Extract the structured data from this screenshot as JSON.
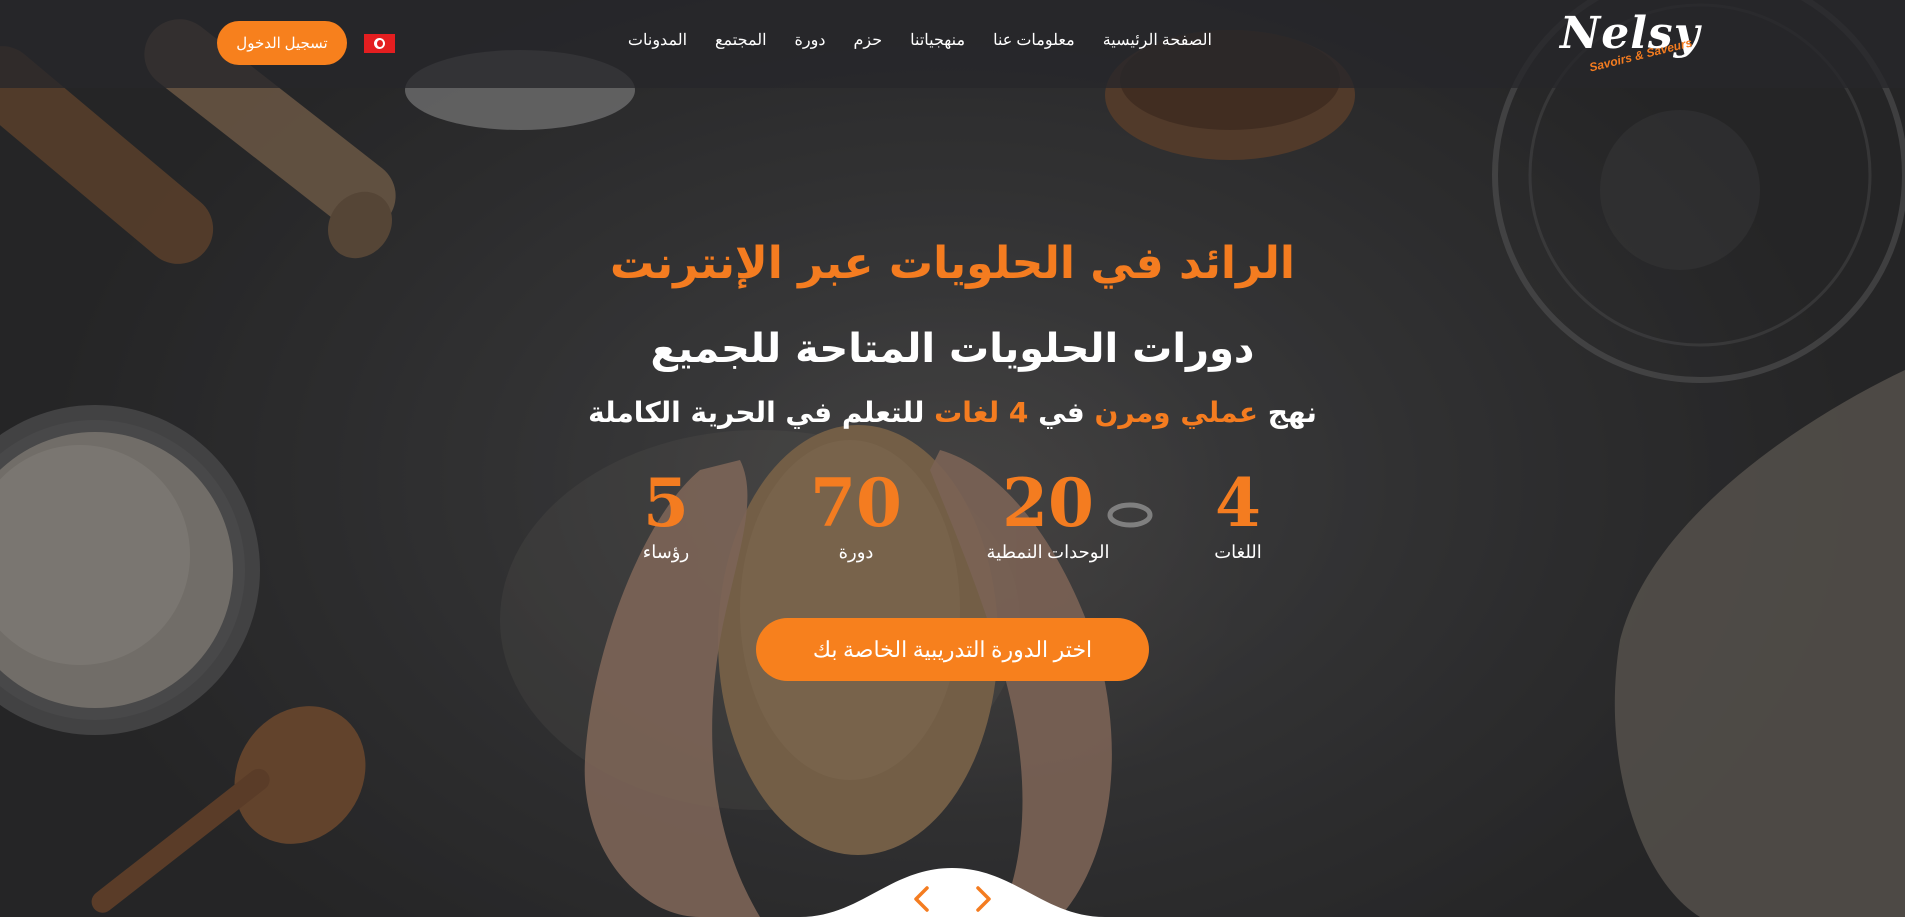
{
  "header": {
    "logo": {
      "brand": "Nelsy",
      "tagline": "Savoirs & Saveurs"
    },
    "nav": [
      {
        "label": "الصفحة الرئيسية"
      },
      {
        "label": "معلومات عنا"
      },
      {
        "label": "منهجياتنا"
      },
      {
        "label": "حزم"
      },
      {
        "label": "دورة"
      },
      {
        "label": "المجتمع"
      },
      {
        "label": "المدونات"
      }
    ],
    "language_flag": "tunisia-flag-icon",
    "login_label": "تسجيل الدخول"
  },
  "hero": {
    "title": "الرائد في الحلويات عبر الإنترنت",
    "subtitle": "دورات الحلويات المتاحة للجميع",
    "tagline": {
      "part1": "نهج",
      "highlight1": "عملي ومرن",
      "part2": "في",
      "highlight2": "4 لغات",
      "part3": "للتعلم في الحرية الكاملة"
    },
    "stats": [
      {
        "value": "4",
        "label": "اللغات"
      },
      {
        "value": "20",
        "label": "الوحدات النمطية"
      },
      {
        "value": "70",
        "label": "دورة"
      },
      {
        "value": "5",
        "label": "رؤساء"
      }
    ],
    "cta_label": "اختر الدورة التدريبية الخاصة بك"
  },
  "slider": {
    "prev_icon": "chevron-left-icon",
    "next_icon": "chevron-right-icon"
  },
  "colors": {
    "accent": "#f47c20",
    "button": "#f7801d",
    "header_bg": "#26262a",
    "text": "#ffffff"
  }
}
